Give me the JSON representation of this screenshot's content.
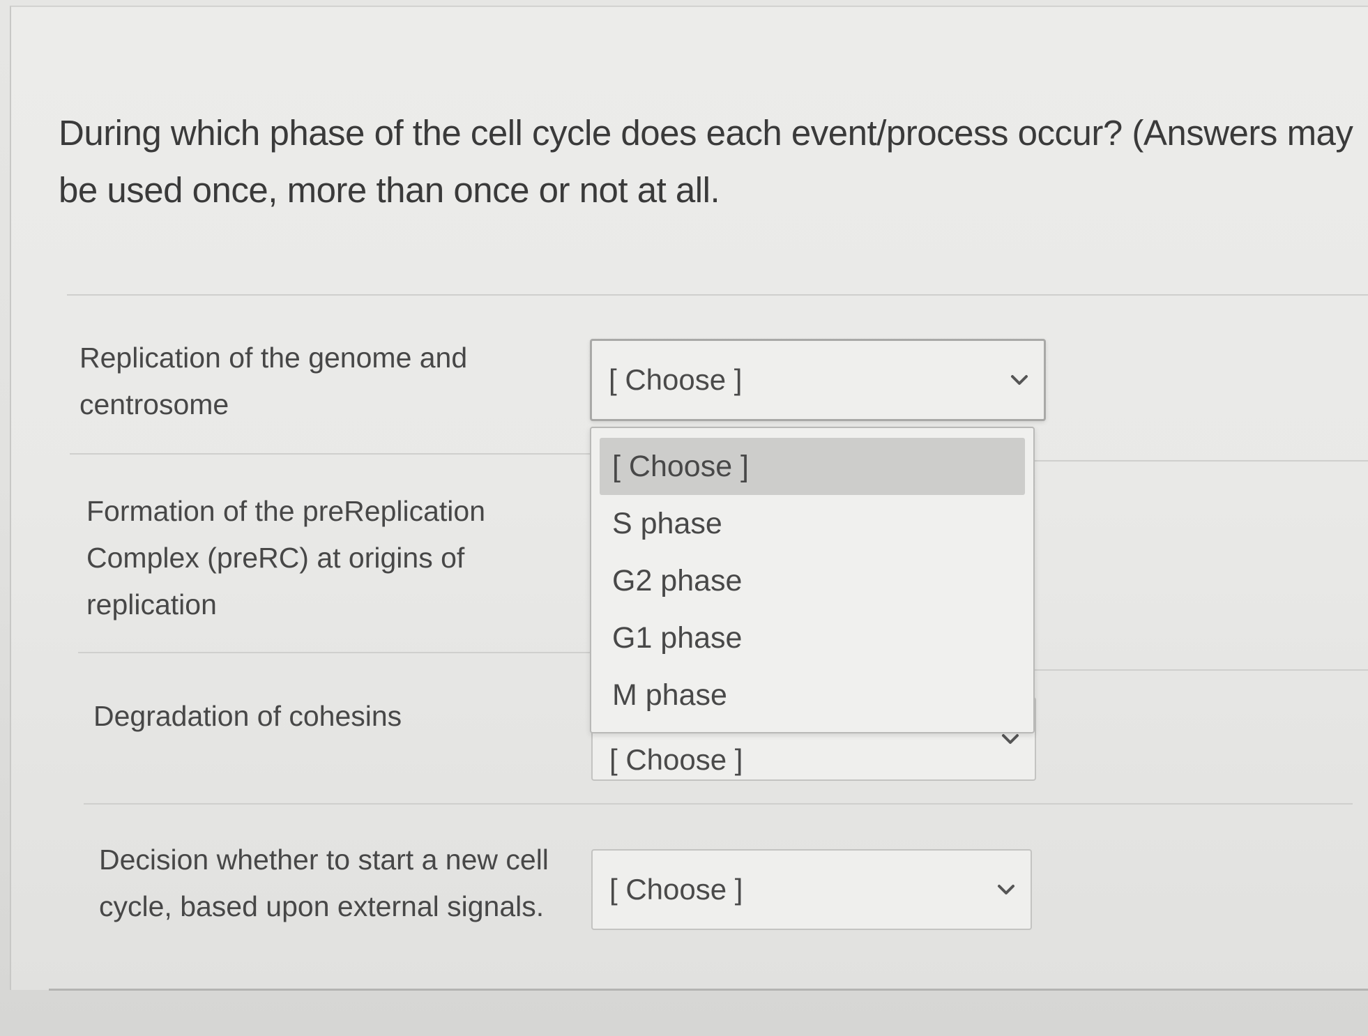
{
  "question": {
    "text": "During which phase of the cell cycle does each event/process occur? (Answers may be used once, more than once or not at all."
  },
  "rows": [
    {
      "label": "Replication of the genome and centrosome",
      "selected": "[ Choose ]"
    },
    {
      "label": "Formation of the preReplication Complex (preRC) at origins of replication",
      "selected": "[ Choose ]"
    },
    {
      "label": "Degradation of cohesins",
      "selected": "[ Choose ]"
    },
    {
      "label": "Decision whether to start a new cell cycle, based upon external signals.",
      "selected": "[ Choose ]"
    }
  ],
  "dropdown": {
    "open_for_row": 0,
    "highlighted_index": 0,
    "options": [
      "[ Choose ]",
      "S phase",
      "G2 phase",
      "G1 phase",
      "M phase"
    ]
  },
  "icons": {
    "select_arrow": "chevron-down-icon"
  },
  "colors": {
    "text": "#3a3a3a",
    "highlight": "#cdcdcb",
    "border": "#c3c3c1"
  }
}
